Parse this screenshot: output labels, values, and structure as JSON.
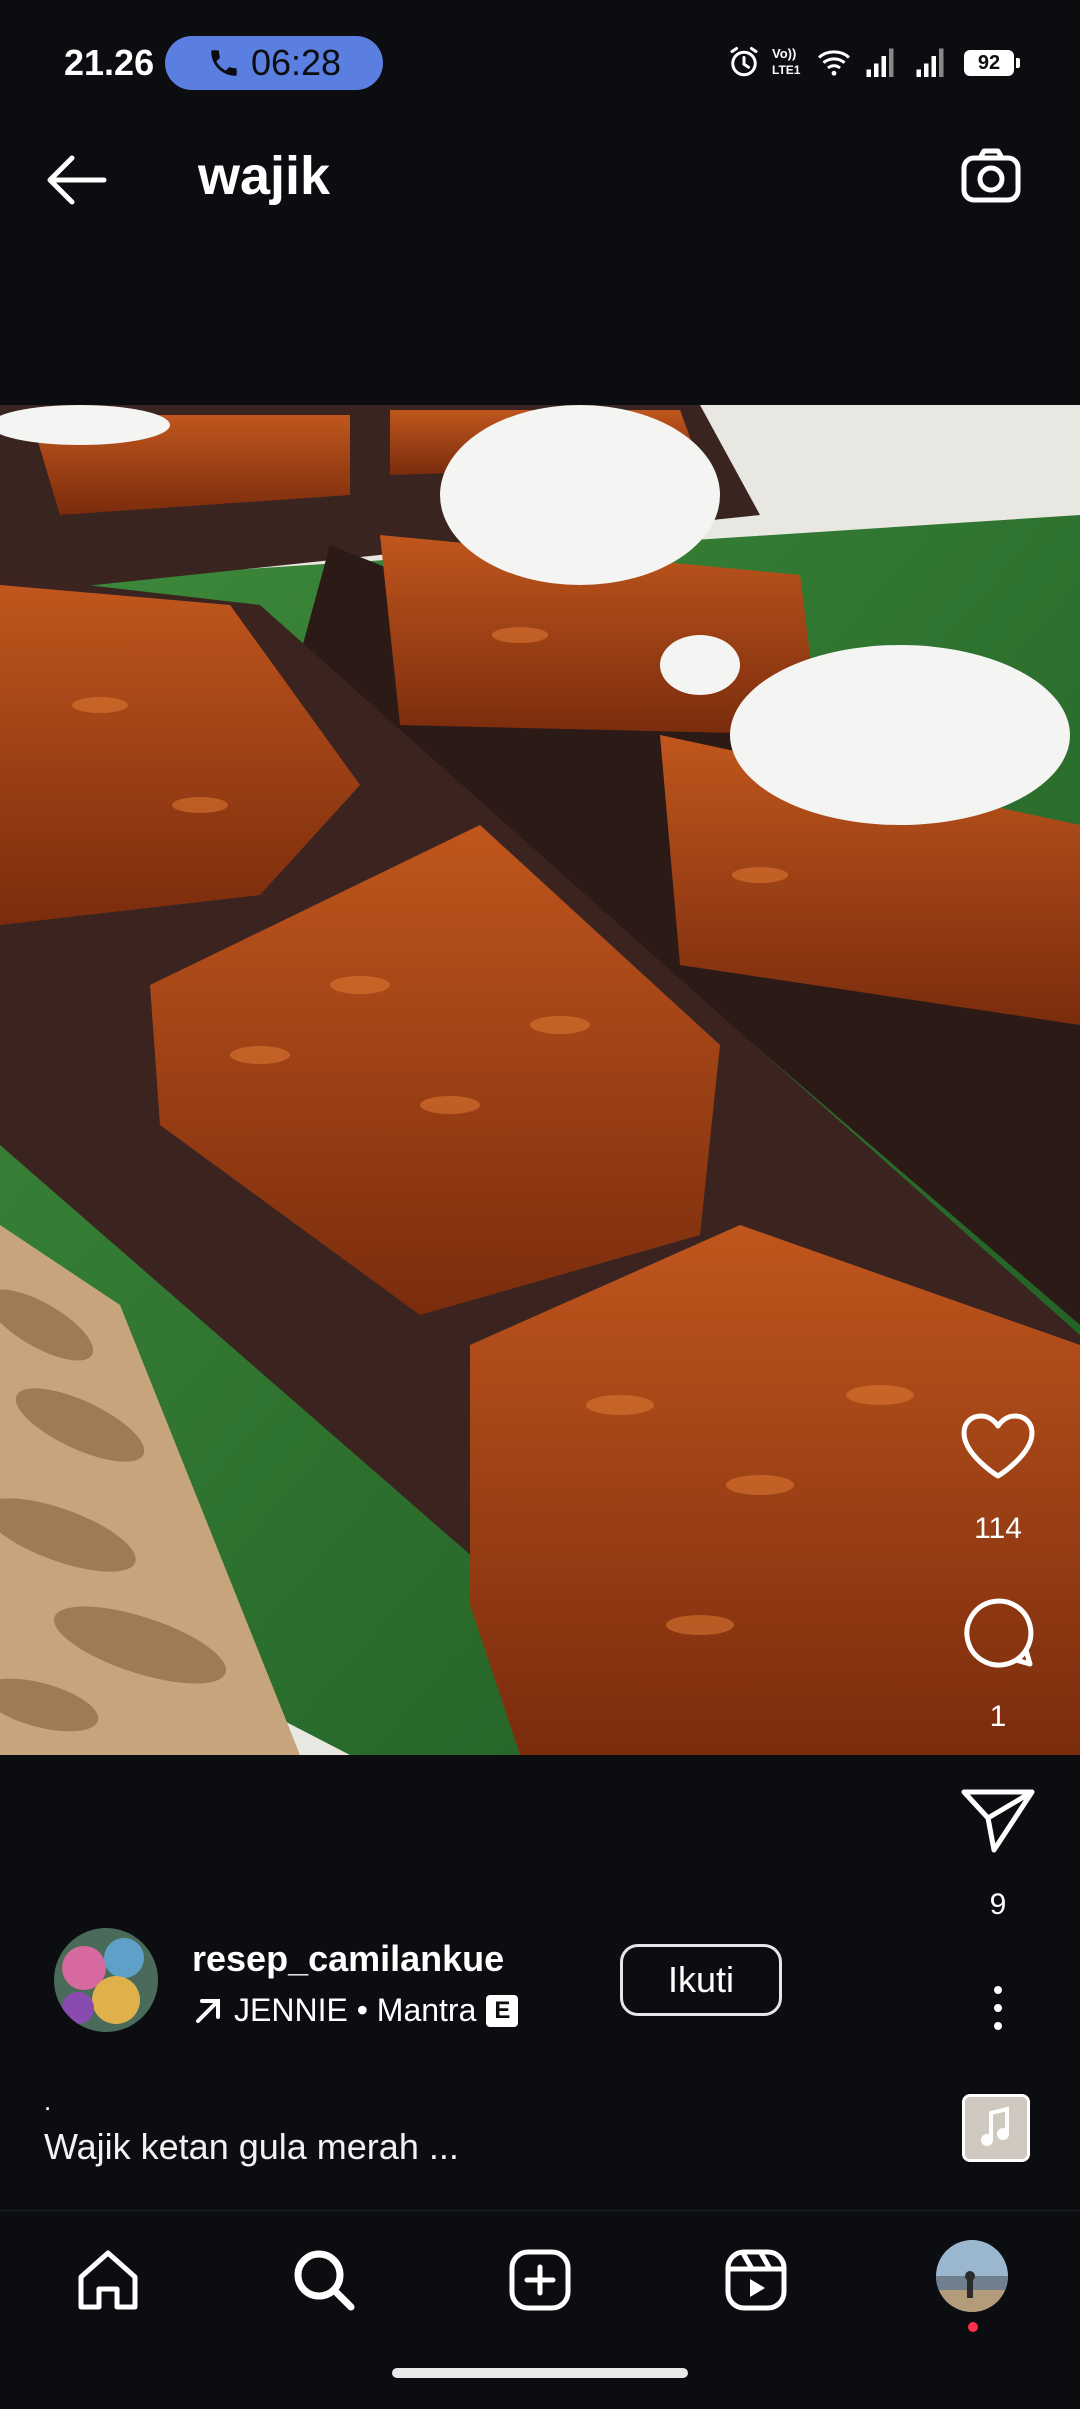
{
  "status_bar": {
    "time": "21.26",
    "call_timer": "06:28",
    "battery": "92",
    "icons": [
      "phone-icon",
      "alarm-icon",
      "volte-icon",
      "wifi-icon",
      "signal-icon",
      "signal-icon",
      "battery-icon"
    ]
  },
  "header": {
    "title": "wajik",
    "back_icon": "arrow-left-icon",
    "camera_icon": "camera-icon"
  },
  "post": {
    "image_alt": "wajik ketan gula merah",
    "likes": "114",
    "comments": "1",
    "shares": "9",
    "author": {
      "username": "resep_camilankue",
      "music": "JENNIE • Mantra",
      "explicit_label": "E",
      "follow_label": "Ikuti"
    },
    "caption_line1": ".",
    "caption": "Wajik ketan gula merah ..."
  },
  "bottom_nav": {
    "items": [
      "home-icon",
      "search-icon",
      "create-icon",
      "reels-icon",
      "profile-avatar"
    ]
  },
  "colors": {
    "background": "#0b0d11",
    "call_pill": "#5b7fe0",
    "notification_dot": "#ff2e4d"
  }
}
